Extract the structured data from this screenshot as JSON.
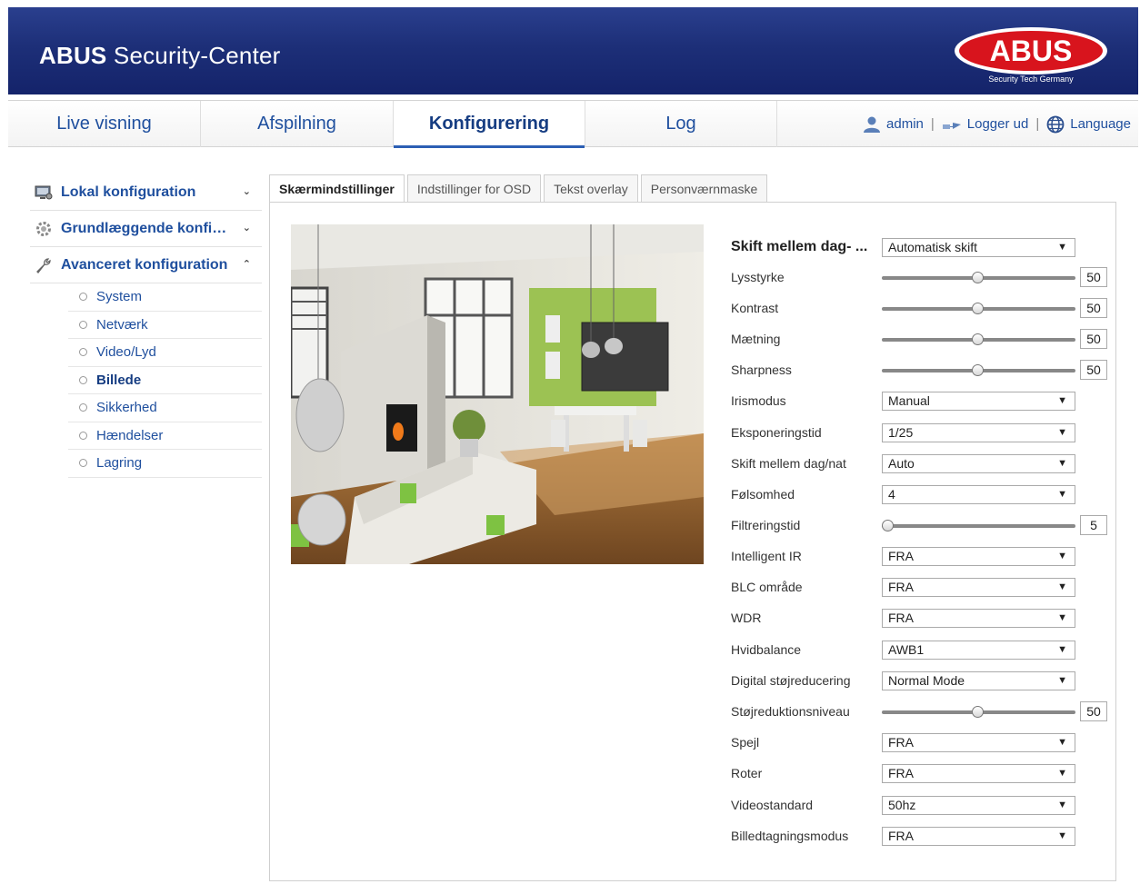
{
  "header": {
    "app_title_bold": "ABUS",
    "app_title_rest": " Security-Center",
    "logo_text": "ABUS",
    "logo_tagline": "Security Tech Germany",
    "brand_color": "#1d2f78",
    "logo_red": "#d8141d"
  },
  "nav": {
    "tabs": [
      "Live visning",
      "Afspilning",
      "Konfigurering",
      "Log"
    ],
    "active_tab": "Konfigurering",
    "user": "admin",
    "logout": "Logger ud",
    "language": "Language",
    "separator": "|"
  },
  "sidebar": {
    "groups": [
      {
        "label": "Lokal konfiguration",
        "icon": "computer-settings-icon",
        "expanded": false
      },
      {
        "label": "Grundlæggende konfi…",
        "icon": "gear-icon",
        "expanded": false
      },
      {
        "label": "Avanceret konfiguration",
        "icon": "wrench-icon",
        "expanded": true
      }
    ],
    "items": [
      "System",
      "Netværk",
      "Video/Lyd",
      "Billede",
      "Sikkerhed",
      "Hændelser",
      "Lagring"
    ],
    "active_item": "Billede"
  },
  "content_tabs": {
    "tabs": [
      "Skærmindstillinger",
      "Indstillinger for OSD",
      "Tekst overlay",
      "Personværnmaske"
    ],
    "active_tab": "Skærmindstillinger"
  },
  "settings": {
    "mode_switch": {
      "label": "Skift mellem dag- ...",
      "value": "Automatisk skift"
    },
    "brightness": {
      "label": "Lysstyrke",
      "value": "50",
      "level": 0.5
    },
    "contrast": {
      "label": "Kontrast",
      "value": "50",
      "level": 0.5
    },
    "saturation": {
      "label": "Mætning",
      "value": "50",
      "level": 0.5
    },
    "sharpness": {
      "label": "Sharpness",
      "value": "50",
      "level": 0.5
    },
    "iris_mode": {
      "label": "Irismodus",
      "value": "Manual"
    },
    "exposure_time": {
      "label": "Eksponeringstid",
      "value": "1/25"
    },
    "day_night": {
      "label": "Skift mellem dag/nat",
      "value": "Auto"
    },
    "sensitivity": {
      "label": "Følsomhed",
      "value": "4"
    },
    "filter_time": {
      "label": "Filtreringstid",
      "value": "5",
      "level": 0.0
    },
    "smart_ir": {
      "label": "Intelligent IR",
      "value": "FRA"
    },
    "blc_area": {
      "label": "BLC område",
      "value": "FRA"
    },
    "wdr": {
      "label": "WDR",
      "value": "FRA"
    },
    "white_balance": {
      "label": "Hvidbalance",
      "value": "AWB1"
    },
    "dnr": {
      "label": "Digital støjreducering",
      "value": "Normal Mode"
    },
    "dnr_level": {
      "label": "Støjreduktionsniveau",
      "value": "50",
      "level": 0.5
    },
    "mirror": {
      "label": "Spejl",
      "value": "FRA"
    },
    "rotate": {
      "label": "Roter",
      "value": "FRA"
    },
    "video_standard": {
      "label": "Videostandard",
      "value": "50hz"
    },
    "capture_mode": {
      "label": "Billedtagningsmodus",
      "value": "FRA"
    }
  }
}
